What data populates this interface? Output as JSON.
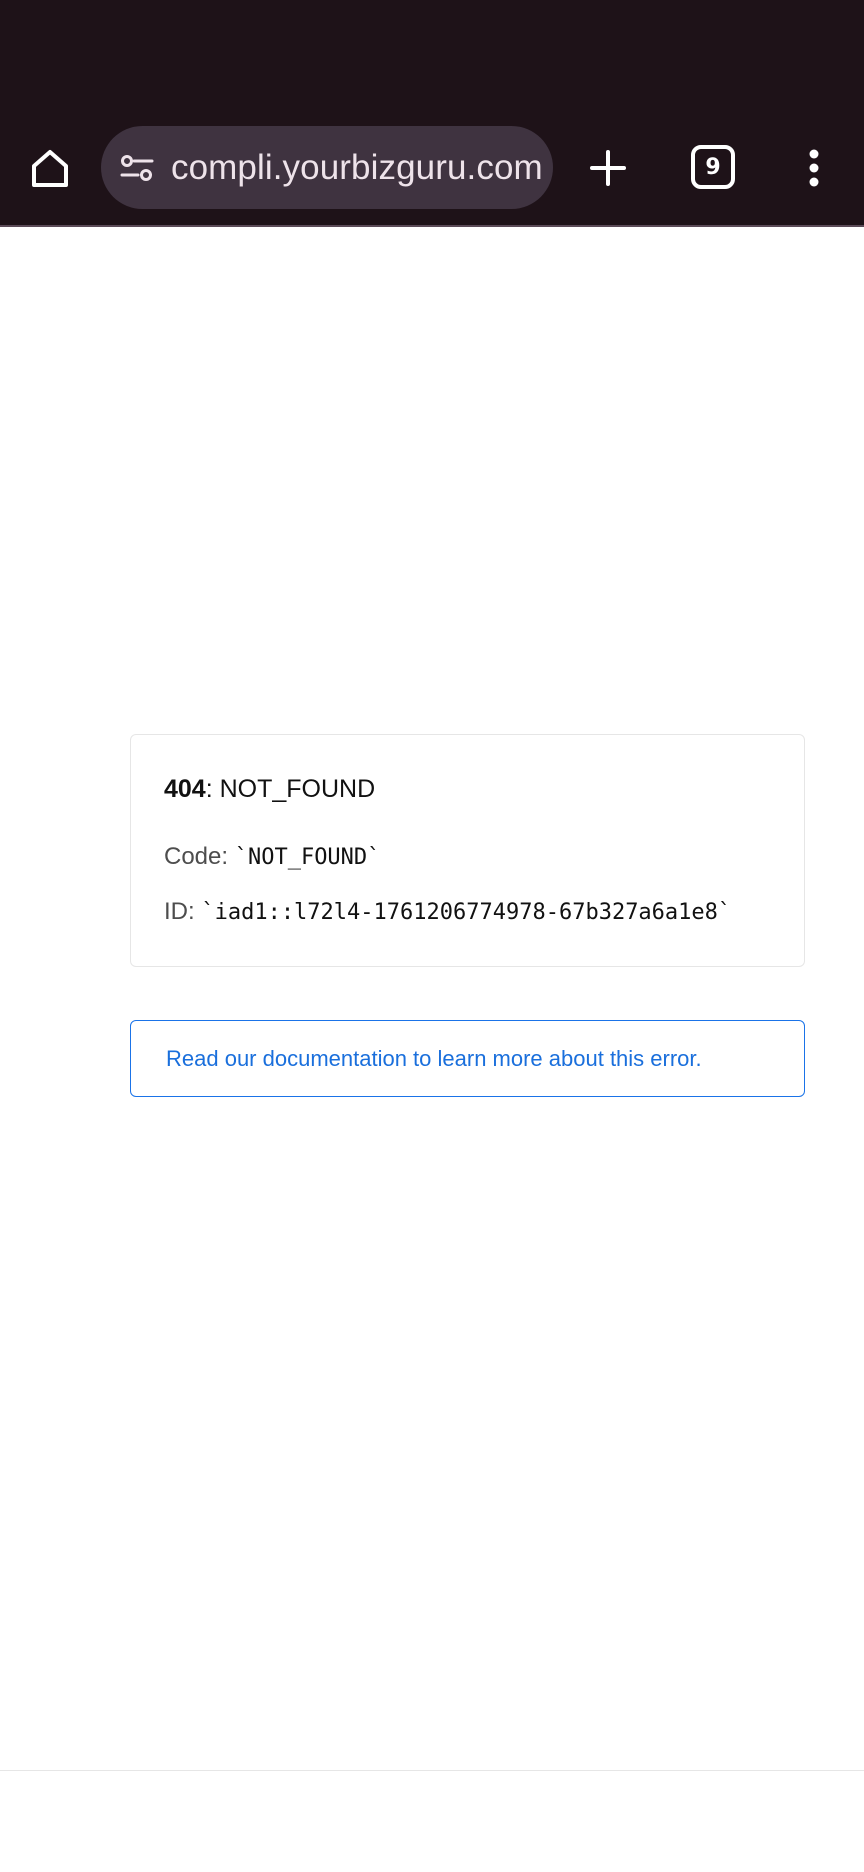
{
  "browser": {
    "url": "compli.yourbizguru.com",
    "tab_count": "9",
    "icons": {
      "home": "home-icon",
      "site_info": "tune-icon",
      "new_tab": "plus-icon",
      "tabs": "tab-switcher-icon",
      "menu": "more-vert-icon"
    }
  },
  "error": {
    "status_code": "404",
    "status_text": ": NOT_FOUND",
    "code_label": "Code: ",
    "code_value": "`NOT_FOUND`",
    "id_label": "ID: ",
    "id_value": "`iad1::l72l4-1761206774978-67b327a6a1e8`"
  },
  "docs": {
    "link_text": "Read our documentation to learn more about this error."
  },
  "colors": {
    "toolbar_bg": "#1e1218",
    "omnibox_bg": "#3f3340",
    "link": "#1a6fdc",
    "link_border": "#1a73e8"
  }
}
